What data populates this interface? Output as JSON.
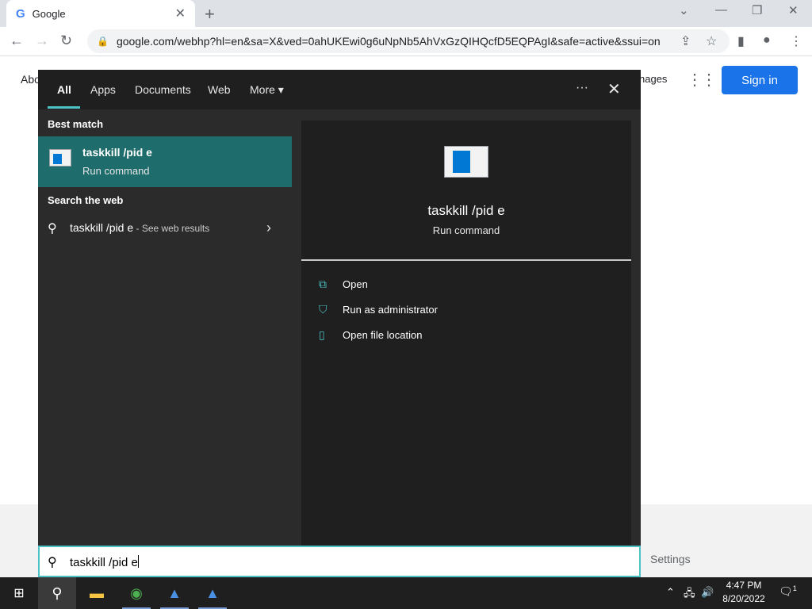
{
  "browser": {
    "tab_title": "Google",
    "tab_icon": "google-logo",
    "url": "google.com/webhp?hl=en&sa=X&ved=0ahUKEwi0g6uNpNb5AhVxGzQIHQcfD5EQPAgI&safe=active&ssui=on",
    "new_tab_label": "+",
    "page": {
      "about_link": "Abo",
      "images_link": "nages",
      "sign_in_button": "Sign in",
      "footer_settings": "Settings"
    }
  },
  "start_search": {
    "tabs": [
      "All",
      "Apps",
      "Documents",
      "Web",
      "More"
    ],
    "more_arrow": "▾",
    "ellipsis": "···",
    "close": "✕",
    "best_match_label": "Best match",
    "best_match": {
      "title": "taskkill /pid e",
      "subtitle": "Run command"
    },
    "search_web_label": "Search the web",
    "web_result": {
      "query": "taskkill /pid e",
      "hint": " - See web results"
    },
    "detail": {
      "title": "taskkill /pid e",
      "subtitle": "Run command",
      "actions": [
        {
          "icon": "open-icon",
          "label": "Open"
        },
        {
          "icon": "shield-icon",
          "label": "Run as administrator"
        },
        {
          "icon": "file-location-icon",
          "label": "Open file location"
        }
      ]
    },
    "search_box_value": "taskkill /pid e"
  },
  "taskbar": {
    "time": "4:47 PM",
    "date": "8/20/2022",
    "notification_count": "1",
    "accent_color": "#4cc2c4"
  }
}
